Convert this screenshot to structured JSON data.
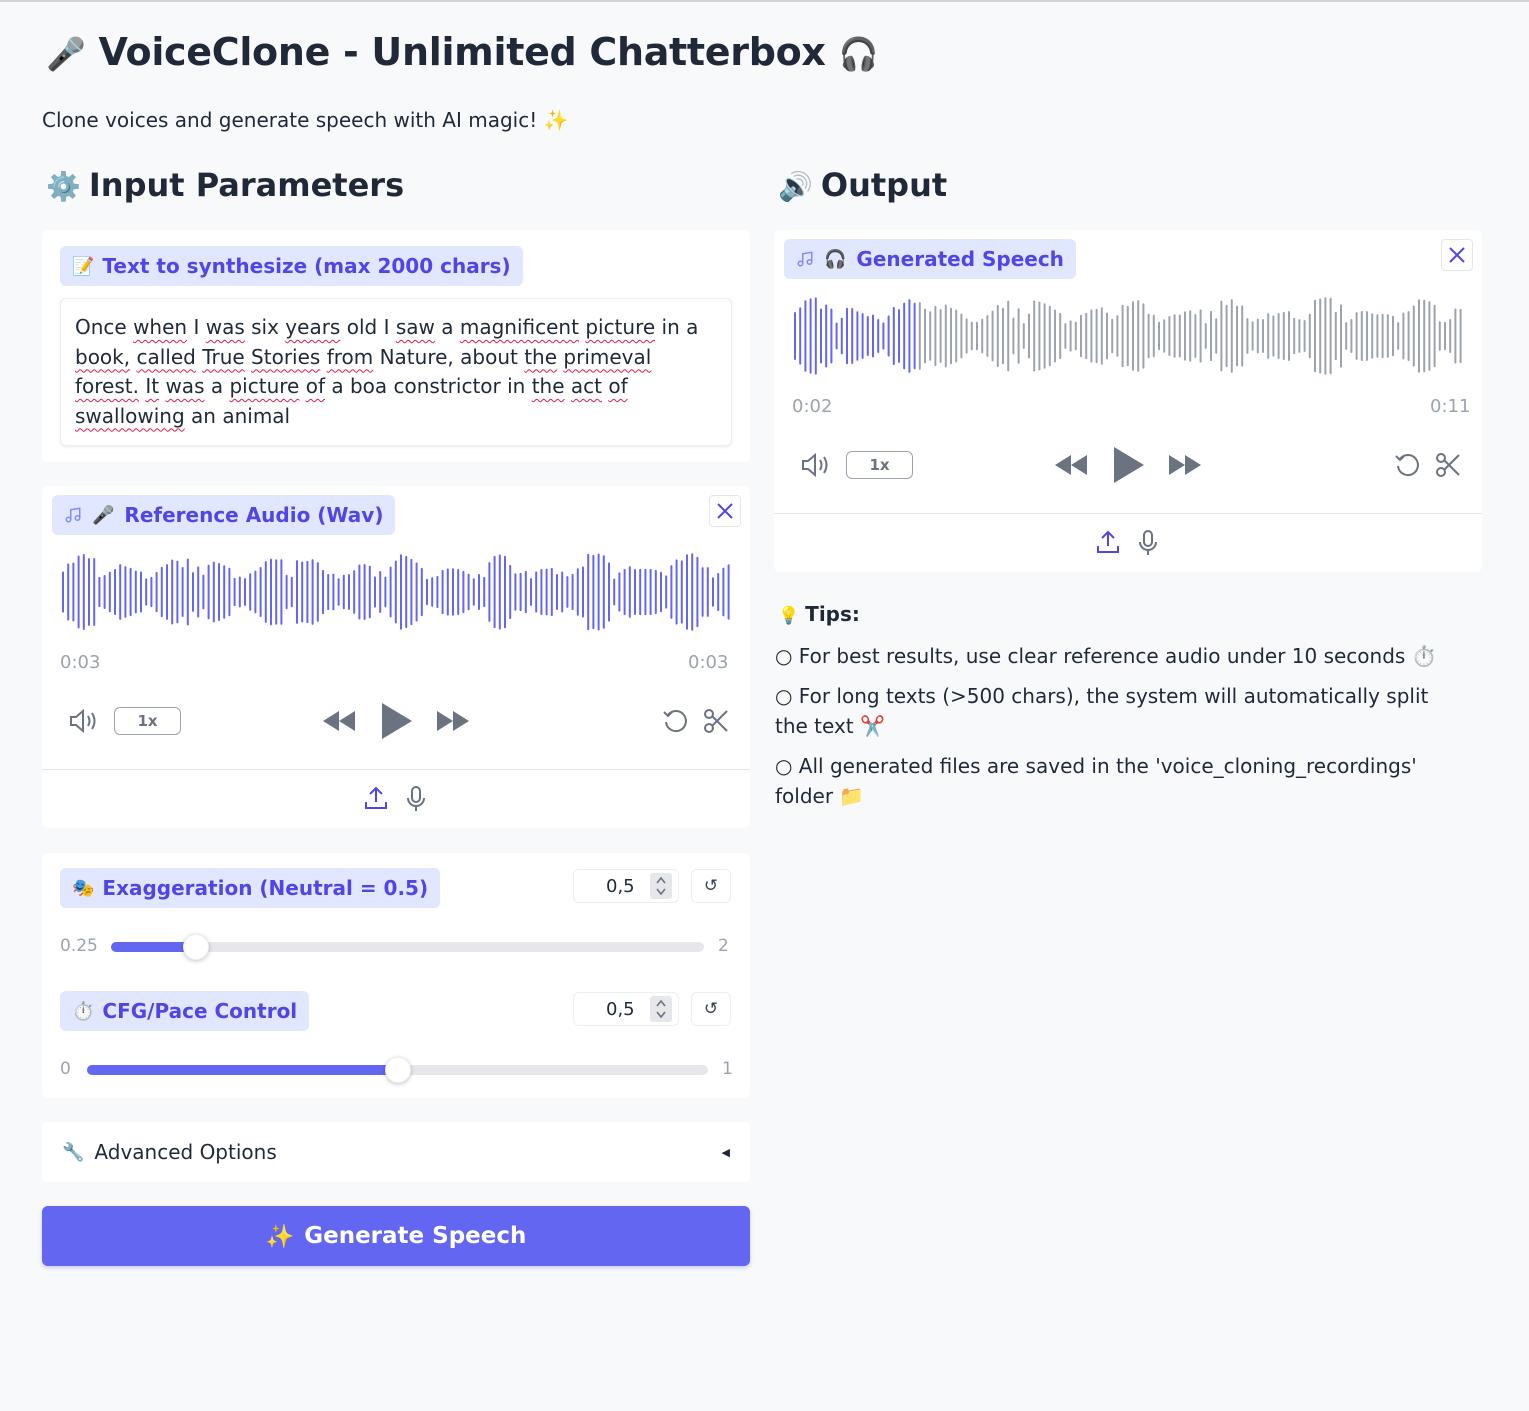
{
  "header": {
    "title_icon": "🎤",
    "title": "VoiceClone - Unlimited Chatterbox",
    "title_trailing_icon": "🎧",
    "subtitle": "Clone voices and generate speech with AI magic! ✨"
  },
  "input_section": {
    "icon": "⚙️",
    "heading": "Input Parameters",
    "text_field": {
      "label_icon": "📝",
      "label": "Text to synthesize (max 2000 chars)",
      "value": "Once when I was six years old I saw a magnificent picture in a book, called True Stories from Nature, about the primeval forest. It was a picture of a boa constrictor in the act of swallowing an animal"
    },
    "reference_audio": {
      "label_icon": "🎤",
      "label": "Reference Audio (Wav)",
      "time_current": "0:03",
      "time_total": "0:03",
      "speed": "1x",
      "progress": 1.0
    },
    "exaggeration": {
      "label_icon": "🎭",
      "label": "Exaggeration (Neutral = 0.5)",
      "value": "0,5",
      "reset": "↺",
      "min_label": "0.25",
      "max_label": "2",
      "min": 0.25,
      "max": 2,
      "current": 0.5
    },
    "cfg": {
      "label_icon": "⏱️",
      "label": "CFG/Pace Control",
      "value": "0,5",
      "reset": "↺",
      "min_label": "0",
      "max_label": "1",
      "min": 0,
      "max": 1,
      "current": 0.5
    },
    "advanced": {
      "icon": "🔧",
      "label": "Advanced Options",
      "arrow": "◀"
    },
    "generate_button": {
      "icon": "✨",
      "label": "Generate Speech"
    }
  },
  "output_section": {
    "icon": "🔊",
    "heading": "Output",
    "generated_audio": {
      "label_icon": "🎧",
      "label": "Generated Speech",
      "time_current": "0:02",
      "time_total": "0:11",
      "speed": "1x",
      "progress": 0.18
    },
    "tips": {
      "icon": "💡",
      "heading": "Tips:",
      "items": [
        "○ For best results, use clear reference audio under 10 seconds ⏱️",
        "○ For long texts (>500 chars), the system will automatically split the text ✂️",
        "○ All generated files are saved in the 'voice_cloning_recordings' folder 📁"
      ]
    }
  },
  "colors": {
    "accent": "#6366f1",
    "chip_bg": "#e0e7ff",
    "chip_text": "#4f46e5",
    "wave_unplayed": "#9ca3af"
  }
}
